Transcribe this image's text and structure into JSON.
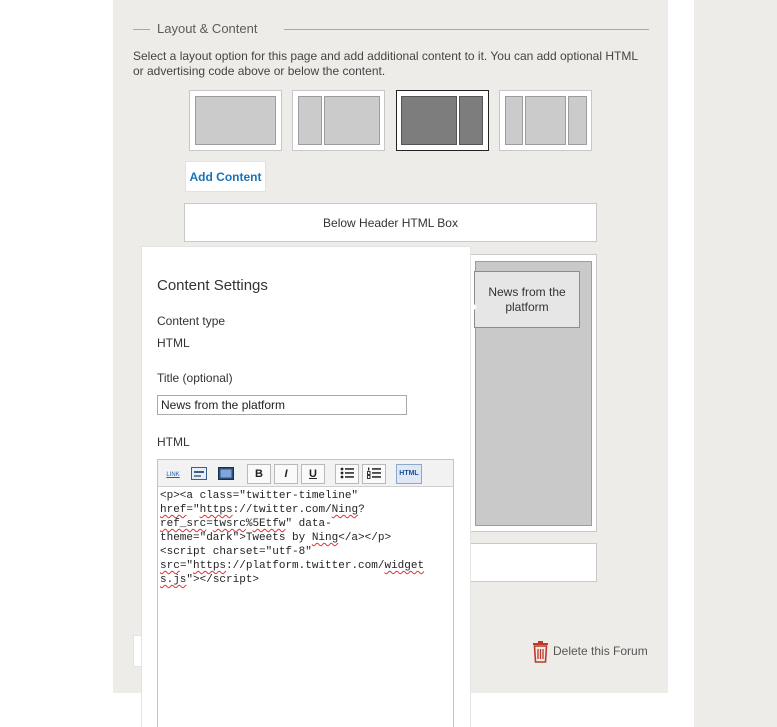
{
  "section": {
    "title": "Layout & Content",
    "description": "Select a layout option for this page and add additional content to it. You can add optional HTML or advertising code above or below the content."
  },
  "layout_options": [
    "single-column",
    "two-column-left-sidebar",
    "two-column-right-sidebar",
    "three-column"
  ],
  "selected_layout": "two-column-right-sidebar",
  "add_content_label": "Add Content",
  "below_header_label": "Below Header HTML Box",
  "module_label": "News from the platform",
  "delete_label": "Delete this Forum",
  "popup": {
    "heading": "Content Settings",
    "content_type_label": "Content type",
    "content_type_value": "HTML",
    "title_label": "Title (optional)",
    "title_value": "News from the platform",
    "html_label": "HTML"
  },
  "toolbar": {
    "link_label": "LINK",
    "bold_label": "B",
    "italic_label": "I",
    "underline_label": "U",
    "html_label": "HTML"
  },
  "code": {
    "l1": "<p><a class=\"twitter-timeline\"",
    "l2a": "href",
    "l2b": "=\"",
    "l2c": "https",
    "l2d": "://",
    "l2e": "twitter.com",
    "l2f": "/",
    "l2g": "Ning",
    "l2h": "?",
    "l3a": "ref_src",
    "l3b": "=",
    "l3c": "twsrc",
    "l3d": "%",
    "l3e": "5Etfw",
    "l3f": "\" data-",
    "l4a": "theme=\"dark\">Tweets by ",
    "l4b": "Ning",
    "l4c": "</a></p>",
    "l5": "<script charset=\"utf-8\"",
    "l6a": "src",
    "l6b": "=\"",
    "l6c": "https",
    "l6d": "://",
    "l6e": "platform.twitter.com",
    "l6f": "/",
    "l6g": "widget",
    "l7a": "s.js",
    "l7b": "\"></",
    "l7c": "script",
    "l7d": ">"
  },
  "colors": {
    "panel_bg": "#edece8",
    "link_blue": "#1a73b8",
    "delete_red": "#c0392b",
    "selected_block": "#7d7d7d"
  }
}
